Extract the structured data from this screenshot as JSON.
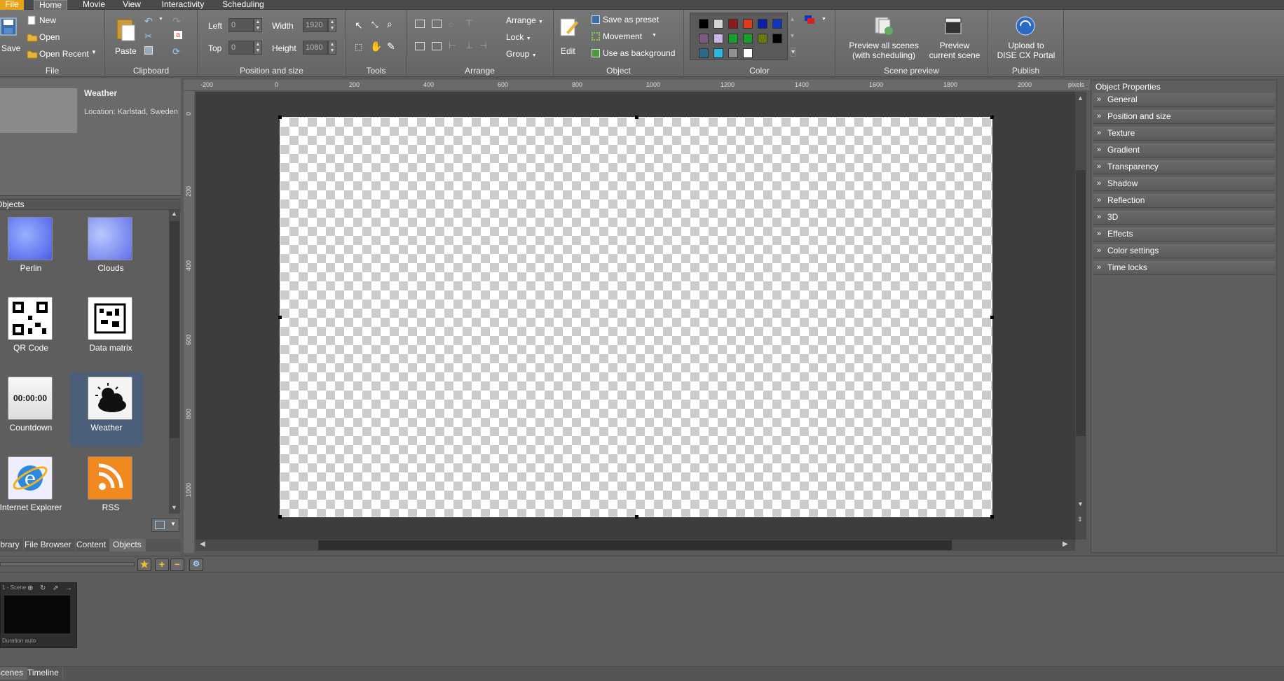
{
  "menu": {
    "tabs": [
      "File",
      "Home",
      "Movie",
      "View",
      "Interactivity",
      "Scheduling"
    ]
  },
  "ribbon": {
    "file": {
      "save": "Save",
      "new": "New",
      "open": "Open",
      "open_recent": "Open Recent",
      "label": "File"
    },
    "clipboard": {
      "paste": "Paste",
      "label": "Clipboard"
    },
    "position": {
      "left_label": "Left",
      "left_value": "0",
      "top_label": "Top",
      "top_value": "0",
      "width_label": "Width",
      "width_value": "1920",
      "height_label": "Height",
      "height_value": "1080",
      "label": "Position and size"
    },
    "tools": {
      "label": "Tools"
    },
    "arrange": {
      "arrange": "Arrange",
      "lock": "Lock",
      "group": "Group",
      "label": "Arrange"
    },
    "object": {
      "edit": "Edit",
      "save_preset": "Save as preset",
      "movement": "Movement",
      "use_bg": "Use as background",
      "label": "Object"
    },
    "color": {
      "label": "Color",
      "swatches": [
        "#000000",
        "#d4d4d4",
        "#8b1a1a",
        "#e03b1c",
        "#0b1fa8",
        "#1236b8",
        "#7a5a82",
        "#c8b8e8",
        "#14a02a",
        "#14a02a",
        "#6a7a0a",
        "#000000",
        "#2a6b8a",
        "#2ab8e0",
        "#909090",
        "#ffffff"
      ]
    },
    "scene_preview": {
      "preview_all": "Preview all scenes",
      "preview_all_sub": "(with scheduling)",
      "preview_current": "Preview",
      "preview_current_sub": "current scene",
      "label": "Scene preview"
    },
    "publish": {
      "upload": "Upload to",
      "upload_sub": "DISE CX Portal",
      "label": "Publish"
    }
  },
  "left": {
    "preview_title": "Weather",
    "preview_location": "Location: Karlstad, Sweden",
    "objects_header": "Objects",
    "objects": [
      {
        "label": "Perlin",
        "icon": "perlin-icon"
      },
      {
        "label": "Clouds",
        "icon": "clouds-icon"
      },
      {
        "label": "QR Code",
        "icon": "qr-code-icon"
      },
      {
        "label": "Data matrix",
        "icon": "data-matrix-icon"
      },
      {
        "label": "Countdown",
        "icon": "countdown-icon",
        "clock": "00:00:00"
      },
      {
        "label": "Weather",
        "icon": "weather-icon"
      },
      {
        "label": "Internet Explorer",
        "icon": "internet-explorer-icon"
      },
      {
        "label": "RSS",
        "icon": "rss-icon"
      }
    ],
    "tabs": [
      "Library",
      "File Browser",
      "Content",
      "Objects"
    ]
  },
  "ruler": {
    "top": [
      "-200",
      "0",
      "200",
      "400",
      "600",
      "800",
      "1000",
      "1200",
      "1400",
      "1600",
      "1800",
      "2000"
    ],
    "unit": "pixels",
    "left": [
      "0",
      "200",
      "400",
      "600",
      "800",
      "1000"
    ]
  },
  "properties": {
    "title": "Object Properties",
    "sections": [
      "General",
      "Position and size",
      "Texture",
      "Gradient",
      "Transparency",
      "Shadow",
      "Reflection",
      "3D",
      "Effects",
      "Color settings",
      "Time locks"
    ]
  },
  "scene": {
    "name": "1 - Scene",
    "duration": "Duration auto"
  },
  "bottom_tabs": [
    "Scenes",
    "Timeline"
  ]
}
